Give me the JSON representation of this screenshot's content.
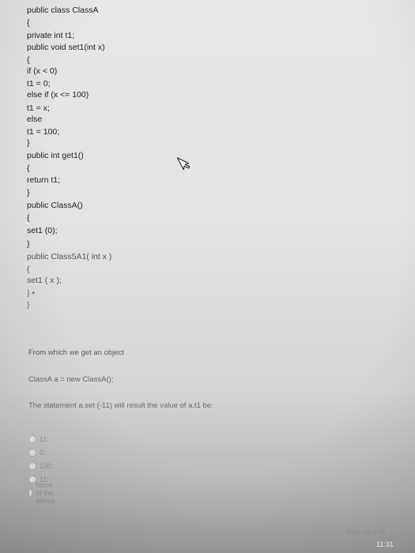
{
  "code": [
    "public class ClassA",
    "{",
    "private int t1;",
    "public void set1(int x)",
    "{",
    "if (x < 0)",
    "t1 = 0;",
    "else if (x <= 100)",
    "t1 = x;",
    "else",
    "t1 = 100;",
    "}",
    "public int get1()",
    "{",
    "return t1;",
    "}",
    "public ClassA()",
    "{",
    "set1 (0);",
    "}",
    "public Class5A1( int x )",
    "{",
    "set1 ( x );",
    "} •",
    "}"
  ],
  "question": {
    "line1": "From which we get an object",
    "line2": "ClassA a = new ClassA();",
    "line3": "The statement a.set (-11) will result the value of a.t1 be:"
  },
  "options": [
    "11:",
    "0:",
    "100:",
    "11:",
    "None of the above"
  ],
  "footer": {
    "page": "Page 24 of 40",
    "left": "Next Page",
    "clock": "11:31"
  }
}
